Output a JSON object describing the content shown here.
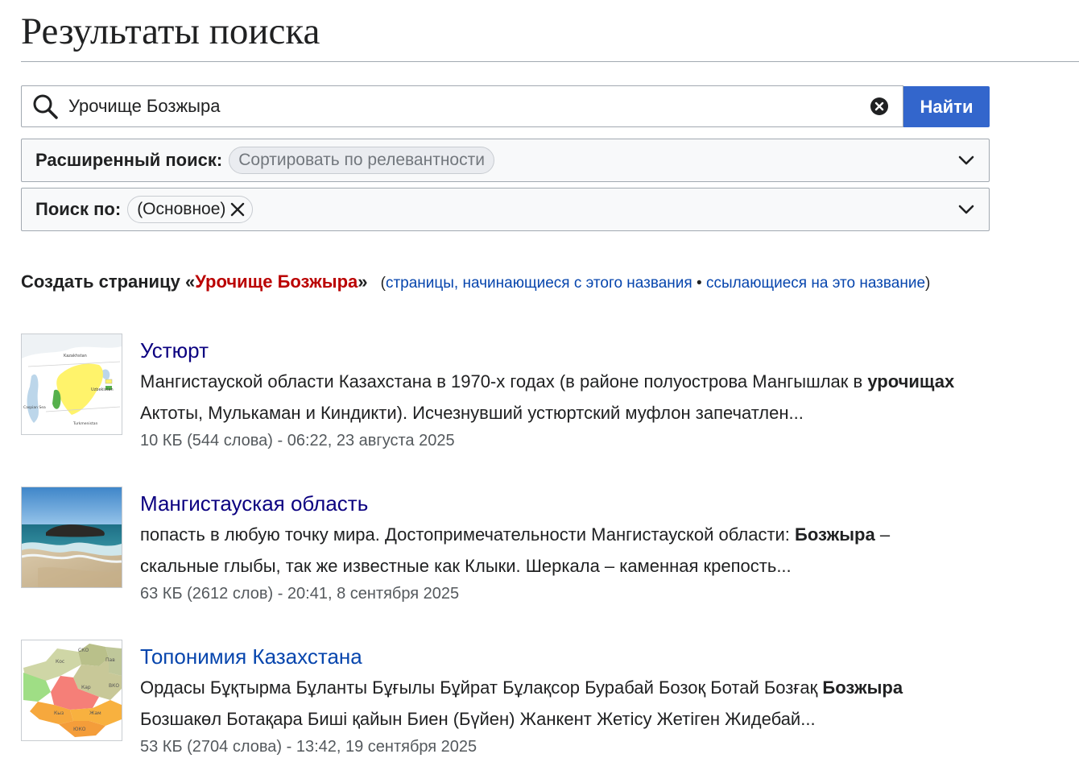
{
  "page": {
    "title": "Результаты поиска"
  },
  "search": {
    "query": "Урочище Бозжыра",
    "button_label": "Найти"
  },
  "advanced": {
    "label": "Расширенный поиск:",
    "sort_chip": "Сортировать по релевантности"
  },
  "namespace": {
    "label": "Поиск по:",
    "chip": "(Основное)"
  },
  "create": {
    "prefix": "Создать страницу «",
    "page_name": "Урочище Бозжыра",
    "suffix": "»",
    "paren_open": "(",
    "link_starting": "страницы, начинающиеся с этого названия",
    "bullet": " • ",
    "link_linking": "ссылающиеся на это название",
    "paren_close": ")"
  },
  "results": [
    {
      "title": "Устюрт",
      "snippet_line1_pre": "Мангистауской области Казахстана в 1970-х годах (в районе полуострова Мангышлак в ",
      "snippet_line1_bold": "урочищах",
      "snippet_line2": "Актоты, Мулькаман и Киндикти). Исчезнувший устюртский муфлон запечатлен...",
      "meta": "10 КБ (544 слова) - 06:22, 23 августа 2025",
      "thumb_labels": [
        "Kazakhstan",
        "Uzbekistan",
        "Caspian Sea",
        "Turkmenistan"
      ]
    },
    {
      "title": "Мангистауская область",
      "snippet_line1_pre": "попасть в любую точку мира. Достопримечательности Мангистауской области: ",
      "snippet_line1_bold": "Бозжыра",
      "snippet_line1_post": " –",
      "snippet_line2": "скальные глыбы, так же известные как Клыки. Шеркала – каменная крепость...",
      "meta": "63 КБ (2612 слов) - 20:41, 8 сентября 2025"
    },
    {
      "title": "Топонимия Казахстана",
      "snippet_line1_pre": "Ордасы Бұқтырма Бұланты Бұғылы Бұйрат Бұлақсор Бурабай Бозоқ Ботай Бозғақ ",
      "snippet_line1_bold": "Бозжыра",
      "snippet_line2": "Бозшакөл Ботақара Биші қайын Биен (Бүйен) Жанкент Жетісу Жетіген Жидебай...",
      "meta": "53 КБ (2704 слова) - 13:42, 19 сентября 2025",
      "thumb_labels": [
        "СКО",
        "Кос",
        "Пав",
        "Кар",
        "ВКО",
        "Жам",
        "ЮКО",
        "Кыз"
      ]
    }
  ],
  "colors": {
    "accent": "#3366cc",
    "link": "#0645ad",
    "visited": "#0b0080",
    "redlink": "#ba0000",
    "meta": "#54595d"
  },
  "icons": {
    "search": "search-icon",
    "clear": "clear-icon",
    "chevron": "chevron-down-icon",
    "close": "close-icon"
  }
}
